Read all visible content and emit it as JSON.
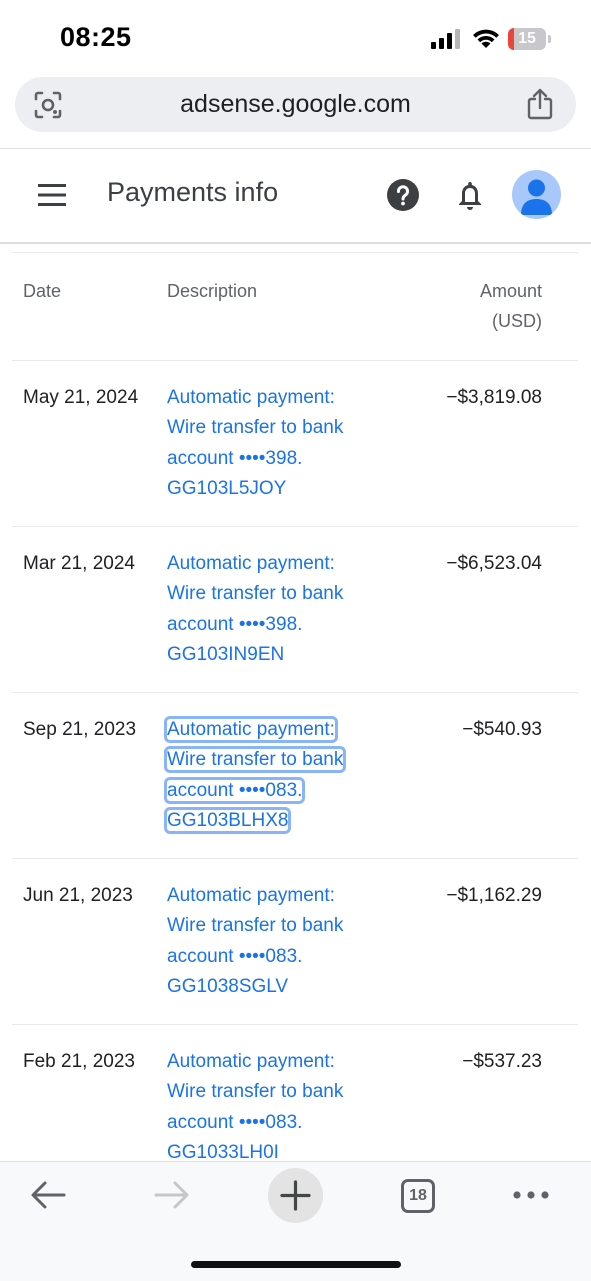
{
  "status_bar": {
    "time": "08:25",
    "battery_level": "15",
    "battery_fraction": 0.15
  },
  "browser": {
    "url": "adsense.google.com",
    "icons": {
      "left": "lens-icon",
      "right": "share-icon"
    }
  },
  "app_bar": {
    "title": "Payments info",
    "icons": [
      "menu-icon",
      "help-icon",
      "bell-icon",
      "avatar"
    ]
  },
  "table": {
    "headers": {
      "date": "Date",
      "description": "Description",
      "amount_line1": "Amount",
      "amount_line2": "(USD)"
    },
    "rows": [
      {
        "date": "May 21, 2024",
        "desc_line1": "Automatic payment:",
        "desc_line2": "Wire transfer to bank",
        "desc_line3": "account ••••398.",
        "desc_line4": "GG103L5JOY",
        "amount": "−$3,819.08"
      },
      {
        "date": "Mar 21, 2024",
        "desc_line1": "Automatic payment:",
        "desc_line2": "Wire transfer to bank",
        "desc_line3": "account ••••398.",
        "desc_line4": "GG103IN9EN",
        "amount": "−$6,523.04"
      },
      {
        "date": "Sep 21, 2023",
        "desc_line1": "Automatic payment:",
        "desc_line2": "Wire transfer to bank",
        "desc_line3": "account ••••083.",
        "desc_line4": "GG103BLHX8",
        "amount": "−$540.93"
      },
      {
        "date": "Jun 21, 2023",
        "desc_line1": "Automatic payment:",
        "desc_line2": "Wire transfer to bank",
        "desc_line3": "account ••••083.",
        "desc_line4": "GG1038SGLV",
        "amount": "−$1,162.29"
      },
      {
        "date": "Feb 21, 2023",
        "desc_line1": "Automatic payment:",
        "desc_line2": "Wire transfer to bank",
        "desc_line3": "account ••••083.",
        "desc_line4": "GG1033LH0I",
        "amount": "−$537.23"
      }
    ]
  },
  "bottom_bar": {
    "tab_count": "18"
  },
  "colors": {
    "link": "#1a73e8",
    "focus_outline": "#8ab4f8",
    "avatar_bg": "#a8c7fa",
    "avatar_fg": "#1a73e8"
  }
}
